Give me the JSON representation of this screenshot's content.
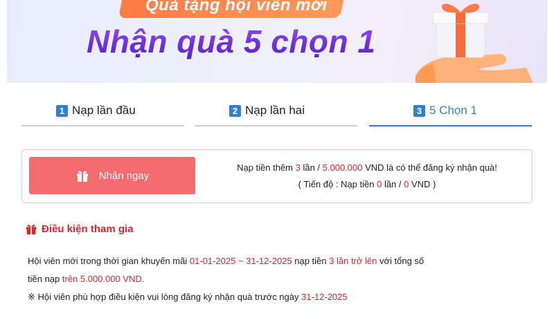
{
  "banner": {
    "ribbon_text": "Quà tặng hội viên mới",
    "headline": "Nhận quà 5 chọn 1"
  },
  "tabs": [
    {
      "num": "1",
      "label": "Nạp lần đầu",
      "active": false
    },
    {
      "num": "2",
      "label": "Nạp lần hai",
      "active": false
    },
    {
      "num": "3",
      "label": "5 Chọn 1",
      "active": true
    }
  ],
  "claim": {
    "button_label": "Nhận ngay",
    "info_prefix": "Nạp tiền thêm ",
    "times": "3",
    "times_unit": " lần / ",
    "amount": "5.000.000",
    "info_suffix": " VND là có thể đăng ký nhận quà!",
    "progress_prefix": "( Tiến độ : Nạp tiền ",
    "progress_times": "0",
    "progress_mid": " lần / ",
    "progress_amount": "0",
    "progress_suffix": " VND )"
  },
  "conditions": {
    "title": "Điều kiện tham gia",
    "line1_a": "Hội viên mới trong thời gian khuyến mãi ",
    "date_range": "01-01-2025 ~ 31-12-2025",
    "line1_b": " nạp tiền ",
    "times_phrase": "3 lần trở lên",
    "line1_c": " với tổng số",
    "line2_a": "tiền nạp ",
    "amount_phrase": "trên 5.000.000 VND.",
    "line3_a": "※ Hội viên phù hợp điều kiện vui lòng đăng ký nhận quà trước ngày ",
    "deadline": "31-12-2025"
  },
  "colors": {
    "accent_blue": "#2f7fd6",
    "highlight_red": "#e0232a",
    "button_red": "#f36b6f"
  }
}
